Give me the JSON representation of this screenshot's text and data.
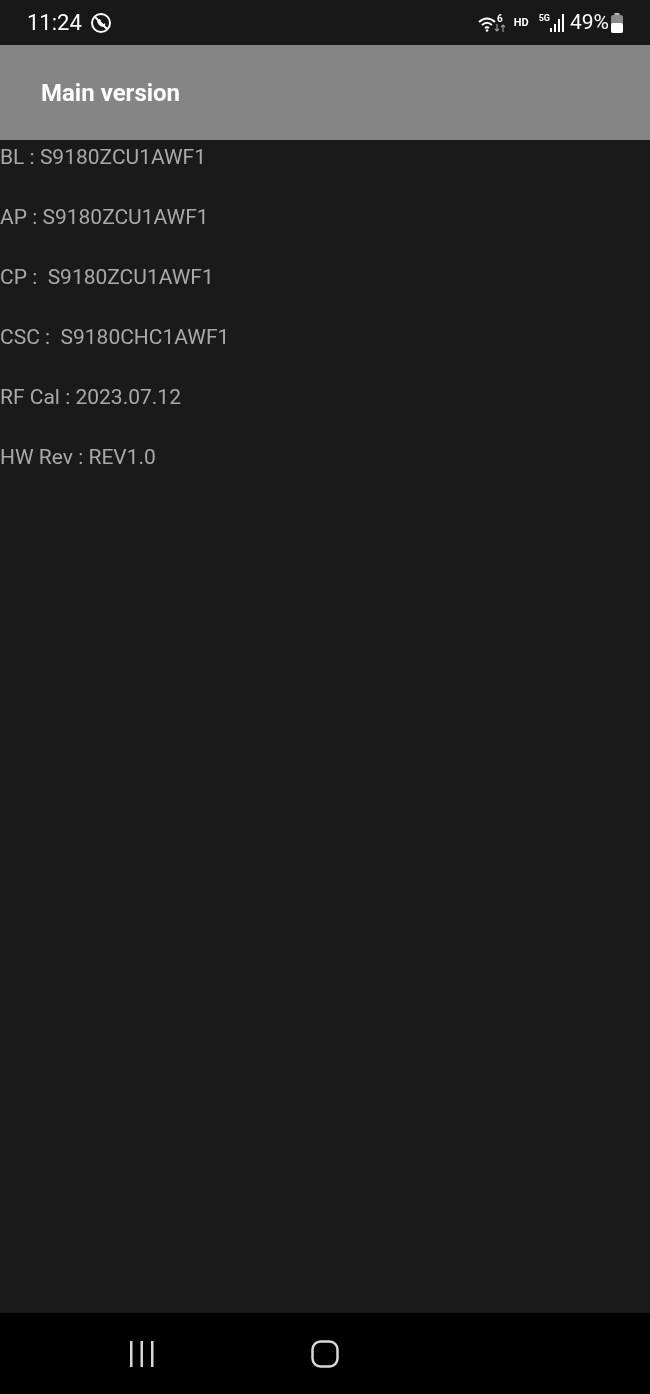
{
  "status_bar": {
    "time": "11:24",
    "wifi_badge": "6",
    "hd": "HD",
    "network": "5G",
    "battery": "49%"
  },
  "app_bar": {
    "title": "Main version"
  },
  "rows": [
    "BL : S9180ZCU1AWF1",
    "AP : S9180ZCU1AWF1",
    "CP :  S9180ZCU1AWF1",
    "CSC :  S9180CHC1AWF1",
    "RF Cal : 2023.07.12",
    "HW Rev : REV1.0"
  ]
}
